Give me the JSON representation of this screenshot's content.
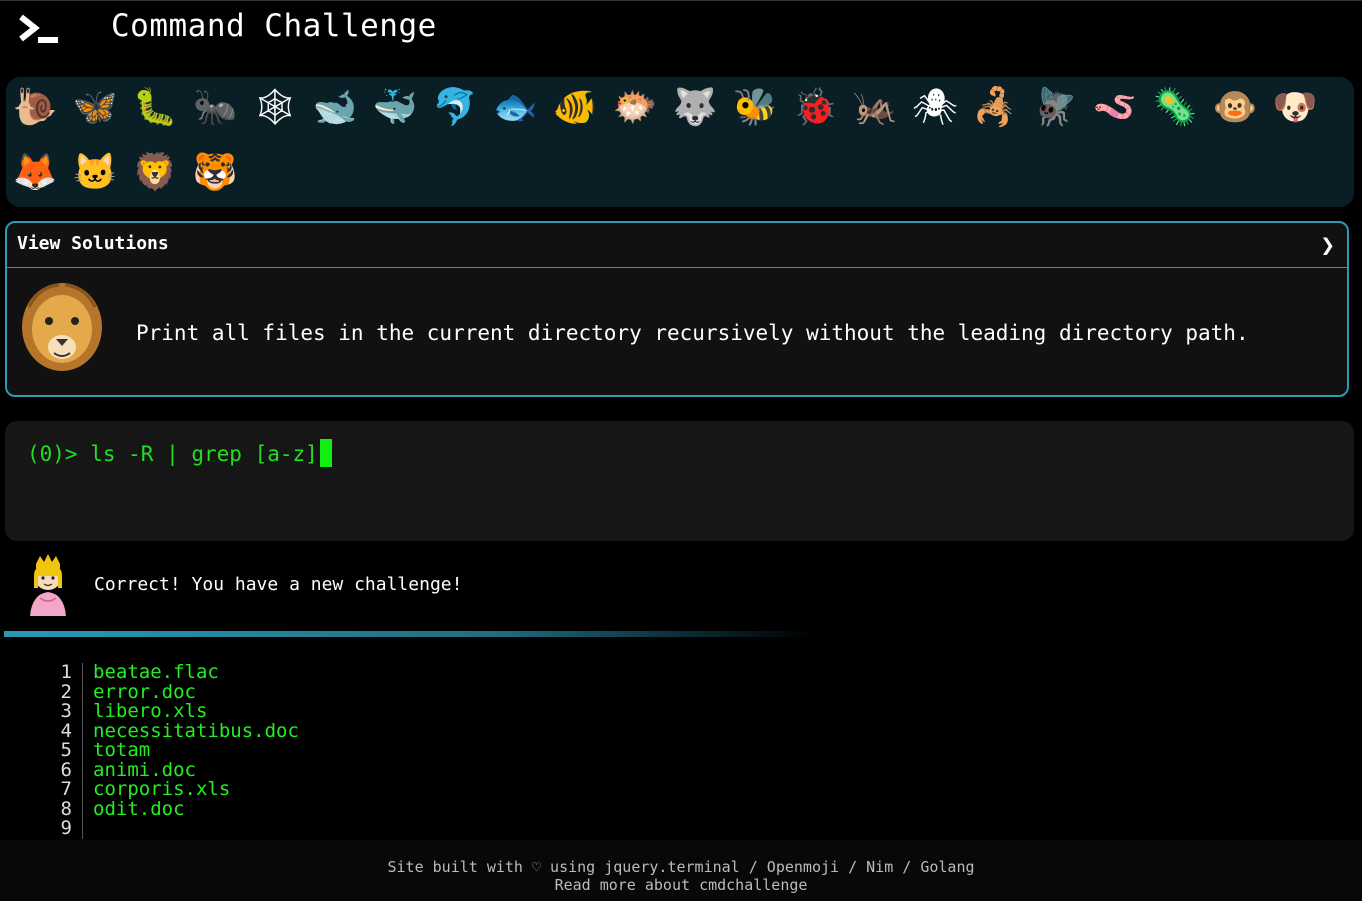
{
  "header": {
    "logo": "terminal-prompt-icon",
    "title": "Command Challenge"
  },
  "emoji_bar": {
    "items": [
      {
        "name": "snail",
        "glyph": "🐌"
      },
      {
        "name": "butterfly",
        "glyph": "🦋"
      },
      {
        "name": "caterpillar",
        "glyph": "🐛"
      },
      {
        "name": "ant",
        "glyph": "🐜"
      },
      {
        "name": "spider-web",
        "glyph": "🕸"
      },
      {
        "name": "whale",
        "glyph": "🐋"
      },
      {
        "name": "spouting-whale",
        "glyph": "🐳"
      },
      {
        "name": "dolphin",
        "glyph": "🐬"
      },
      {
        "name": "fish",
        "glyph": "🐟"
      },
      {
        "name": "tropical-fish",
        "glyph": "🐠"
      },
      {
        "name": "blowfish",
        "glyph": "🐡"
      },
      {
        "name": "wolf",
        "glyph": "🐺"
      },
      {
        "name": "bee",
        "glyph": "🐝"
      },
      {
        "name": "lady-beetle",
        "glyph": "🐞"
      },
      {
        "name": "cricket",
        "glyph": "🦗"
      },
      {
        "name": "spider",
        "glyph": "🕷"
      },
      {
        "name": "scorpion",
        "glyph": "🦂"
      },
      {
        "name": "fly",
        "glyph": "🪰"
      },
      {
        "name": "worm",
        "glyph": "🪱"
      },
      {
        "name": "microbe",
        "glyph": "🦠"
      },
      {
        "name": "monkey",
        "glyph": "🐵"
      },
      {
        "name": "dog",
        "glyph": "🐶"
      },
      {
        "name": "fox",
        "glyph": "🦊"
      },
      {
        "name": "cat",
        "glyph": "🐱"
      },
      {
        "name": "lion",
        "glyph": "🦁"
      },
      {
        "name": "tiger",
        "glyph": "🐯"
      }
    ]
  },
  "challenge": {
    "view_solutions_label": "View Solutions",
    "chevron": "❯",
    "description": "Print all files in the current directory recursively without the leading directory path.",
    "avatar": "lion-icon"
  },
  "terminal": {
    "prompt": "(0)> ",
    "command": "ls -R | grep [a-z]"
  },
  "feedback": {
    "icon": "princess-icon",
    "message": "Correct! You have a new challenge!"
  },
  "output": {
    "lines": [
      {
        "num": "1",
        "text": "beatae.flac"
      },
      {
        "num": "2",
        "text": "error.doc"
      },
      {
        "num": "3",
        "text": "libero.xls"
      },
      {
        "num": "4",
        "text": "necessitatibus.doc"
      },
      {
        "num": "5",
        "text": "totam"
      },
      {
        "num": "6",
        "text": "animi.doc"
      },
      {
        "num": "7",
        "text": "corporis.xls"
      },
      {
        "num": "8",
        "text": "odit.doc"
      },
      {
        "num": "9",
        "text": ""
      }
    ]
  },
  "footer": {
    "line1_prefix": "Site built with ♡ using ",
    "link_jquery": "jquery.terminal",
    "sep": " / ",
    "link_openmoji": "Openmoji",
    "link_nim": "Nim",
    "link_golang": "Golang",
    "line2_prefix": "Read more about ",
    "link_cmdchallenge": "cmdchallenge"
  },
  "colors": {
    "accent": "#2a9ab5",
    "terminal_green": "#22ee22",
    "emoji_bar_bg": "#0a1e26"
  }
}
